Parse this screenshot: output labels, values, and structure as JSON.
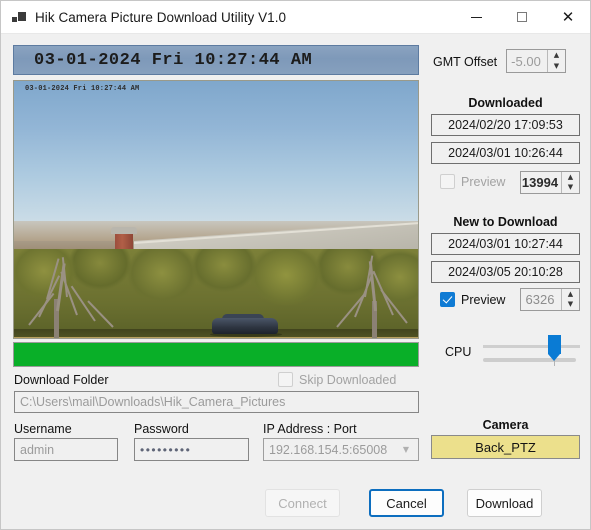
{
  "window": {
    "title": "Hik Camera Picture Download Utility V1.0",
    "icon": "app-squares-icon",
    "minimize_label": "minimize",
    "maximize_label": "maximize",
    "close_label": "close"
  },
  "preview": {
    "timestamp_banner": "03-01-2024 Fri 10:27:44 AM",
    "photo_overlay_timestamp": "03-01-2024 Fri 10:27:44 AM",
    "progress_percent": 100
  },
  "gmt": {
    "label": "GMT Offset",
    "value": "-5.00"
  },
  "downloaded": {
    "heading": "Downloaded",
    "start": "2024/02/20 17:09:53",
    "end": "2024/03/01 10:26:44",
    "preview_label": "Preview",
    "preview_checked": false,
    "count": "13994"
  },
  "new_to_download": {
    "heading": "New to Download",
    "start": "2024/03/01 10:27:44",
    "end": "2024/03/05 20:10:28",
    "preview_label": "Preview",
    "preview_checked": true,
    "count": "6326"
  },
  "cpu": {
    "label": "CPU",
    "value_percent": 68
  },
  "folder": {
    "label": "Download Folder",
    "value": "C:\\Users\\mail\\Downloads\\Hik_Camera_Pictures",
    "skip_label": "Skip Downloaded",
    "skip_checked": false
  },
  "credentials": {
    "username_label": "Username",
    "username_value": "admin",
    "password_label": "Password",
    "password_value": "•••••••••",
    "ip_label": "IP Address : Port",
    "ip_value": "192.168.154.5:65008",
    "ip_dropdown_icon": "chevron-down-icon"
  },
  "camera": {
    "label": "Camera",
    "name": "Back_PTZ"
  },
  "buttons": {
    "connect": "Connect",
    "cancel": "Cancel",
    "download": "Download"
  },
  "colors": {
    "accent": "#0a7bd4",
    "progress_green": "#09af28",
    "camera_yellow": "#ece08c",
    "window_bg": "#f0f0f0"
  }
}
